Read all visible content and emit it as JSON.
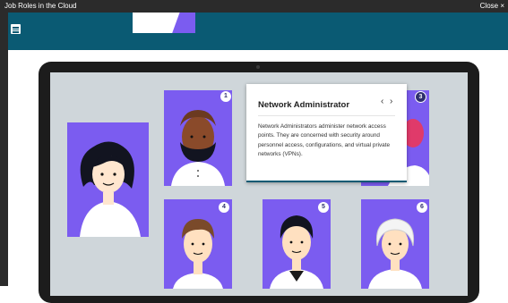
{
  "window": {
    "title": "Job Roles in the Cloud",
    "close_label": "Close ×"
  },
  "header": {
    "menu_icon": "hamburger-menu-icon"
  },
  "cards": [
    {
      "number": "1",
      "person": "person-beard-icon"
    },
    {
      "number": "3",
      "person": "person-partial-icon",
      "active": true
    },
    {
      "number": "4",
      "person": "person-brown-hair-icon"
    },
    {
      "number": "5",
      "person": "person-black-hair-icon"
    },
    {
      "number": "6",
      "person": "person-white-hair-icon"
    }
  ],
  "popup": {
    "title": "Network Administrator",
    "prev_label": "‹",
    "next_label": "›",
    "body": "Network Administrators administer network access points. They are concerned with security around personnel access, configurations, and virtual private networks (VPNs)."
  },
  "colors": {
    "header": "#0a5a73",
    "card": "#7b5cf0",
    "screen": "#cfd6da",
    "badge": "#2e2e6e"
  }
}
